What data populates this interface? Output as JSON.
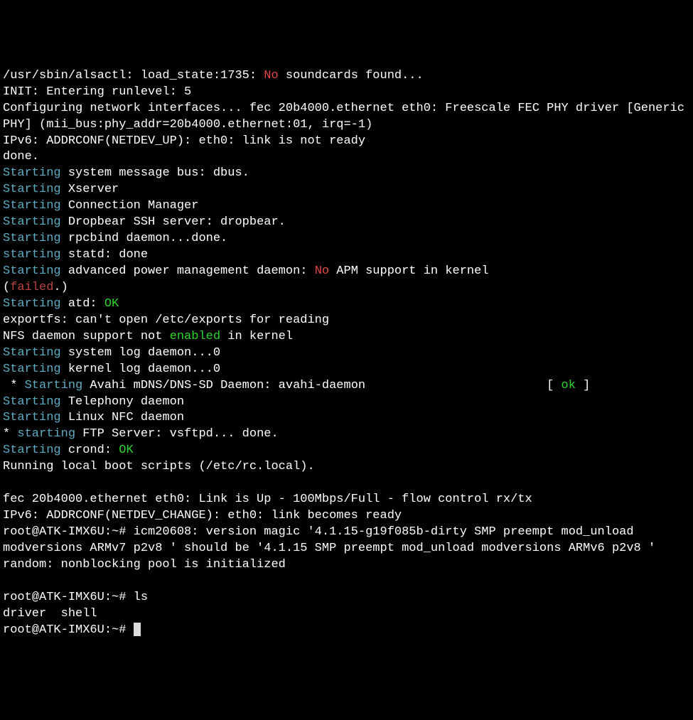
{
  "lines": [
    {
      "segments": [
        {
          "t": "/usr/sbin/alsactl: load_state:1735: ",
          "c": "white"
        },
        {
          "t": "No",
          "c": "red"
        },
        {
          "t": " soundcards found...",
          "c": "white"
        }
      ]
    },
    {
      "segments": [
        {
          "t": "INIT: Entering runlevel: 5",
          "c": "white"
        }
      ]
    },
    {
      "segments": [
        {
          "t": "Configuring network interfaces... fec 20b4000.ethernet eth0: Freescale FEC PHY driver [Generic PHY] (mii_bus:phy_addr=20b4000.ethernet:01, irq=-1)",
          "c": "white"
        }
      ]
    },
    {
      "segments": [
        {
          "t": "IPv6: ADDRCONF(NETDEV_UP): eth0: link is not ready",
          "c": "white"
        }
      ]
    },
    {
      "segments": [
        {
          "t": "done.",
          "c": "white"
        }
      ]
    },
    {
      "segments": [
        {
          "t": "Starting",
          "c": "cyan"
        },
        {
          "t": " system message bus: dbus.",
          "c": "white"
        }
      ]
    },
    {
      "segments": [
        {
          "t": "Starting",
          "c": "cyan"
        },
        {
          "t": " Xserver",
          "c": "white"
        }
      ]
    },
    {
      "segments": [
        {
          "t": "Starting",
          "c": "cyan"
        },
        {
          "t": " Connection Manager",
          "c": "white"
        }
      ]
    },
    {
      "segments": [
        {
          "t": "Starting",
          "c": "cyan"
        },
        {
          "t": " Dropbear SSH server: dropbear.",
          "c": "white"
        }
      ]
    },
    {
      "segments": [
        {
          "t": "Starting",
          "c": "cyan"
        },
        {
          "t": " rpcbind daemon...done.",
          "c": "white"
        }
      ]
    },
    {
      "segments": [
        {
          "t": "starting",
          "c": "cyan"
        },
        {
          "t": " statd: done",
          "c": "white"
        }
      ]
    },
    {
      "segments": [
        {
          "t": "Starting",
          "c": "cyan"
        },
        {
          "t": " advanced power management daemon: ",
          "c": "white"
        },
        {
          "t": "No",
          "c": "red"
        },
        {
          "t": " APM support in kernel",
          "c": "white"
        }
      ]
    },
    {
      "segments": [
        {
          "t": "(",
          "c": "white"
        },
        {
          "t": "failed",
          "c": "darkred"
        },
        {
          "t": ".)",
          "c": "white"
        }
      ]
    },
    {
      "segments": [
        {
          "t": "Starting",
          "c": "cyan"
        },
        {
          "t": " atd: ",
          "c": "white"
        },
        {
          "t": "OK",
          "c": "green"
        }
      ]
    },
    {
      "segments": [
        {
          "t": "exportfs: can't open /etc/exports for reading",
          "c": "white"
        }
      ]
    },
    {
      "segments": [
        {
          "t": "NFS daemon support not ",
          "c": "white"
        },
        {
          "t": "enabled",
          "c": "green"
        },
        {
          "t": " in kernel",
          "c": "white"
        }
      ]
    },
    {
      "segments": [
        {
          "t": "Starting",
          "c": "cyan"
        },
        {
          "t": " system log daemon...0",
          "c": "white"
        }
      ]
    },
    {
      "segments": [
        {
          "t": "Starting",
          "c": "cyan"
        },
        {
          "t": " kernel log daemon...0",
          "c": "white"
        }
      ]
    },
    {
      "segments": [
        {
          "t": " * ",
          "c": "white"
        },
        {
          "t": "Starting",
          "c": "cyan"
        },
        {
          "t": " Avahi mDNS/DNS-SD Daemon: avahi-daemon                         ",
          "c": "white"
        },
        {
          "t": "[ ",
          "c": "white"
        },
        {
          "t": "ok",
          "c": "green"
        },
        {
          "t": " ]",
          "c": "white"
        }
      ]
    },
    {
      "segments": [
        {
          "t": "Starting",
          "c": "cyan"
        },
        {
          "t": " Telephony daemon",
          "c": "white"
        }
      ]
    },
    {
      "segments": [
        {
          "t": "Starting",
          "c": "cyan"
        },
        {
          "t": " Linux NFC daemon",
          "c": "white"
        }
      ]
    },
    {
      "segments": [
        {
          "t": "* ",
          "c": "white"
        },
        {
          "t": "starting",
          "c": "cyan"
        },
        {
          "t": " FTP Server: vsftpd... done.",
          "c": "white"
        }
      ]
    },
    {
      "segments": [
        {
          "t": "Starting",
          "c": "cyan"
        },
        {
          "t": " crond: ",
          "c": "white"
        },
        {
          "t": "OK",
          "c": "green"
        }
      ]
    },
    {
      "segments": [
        {
          "t": "Running local boot scripts (/etc/rc.local).",
          "c": "white"
        }
      ]
    },
    {
      "segments": [
        {
          "t": " ",
          "c": "white"
        }
      ]
    },
    {
      "segments": [
        {
          "t": "fec 20b4000.ethernet eth0: Link is Up - 100Mbps/Full - flow control rx/tx",
          "c": "white"
        }
      ]
    },
    {
      "segments": [
        {
          "t": "IPv6: ADDRCONF(NETDEV_CHANGE): eth0: link becomes ready",
          "c": "white"
        }
      ]
    },
    {
      "segments": [
        {
          "t": "root@ATK-IMX6U:~# icm20608: version magic '4.1.15-g19f085b-dirty SMP preempt mod_unload modversions ARMv7 p2v8 ' should be '4.1.15 SMP preempt mod_unload modversions ARMv6 p2v8 '",
          "c": "white"
        }
      ]
    },
    {
      "segments": [
        {
          "t": "random: nonblocking pool is initialized",
          "c": "white"
        }
      ]
    },
    {
      "segments": [
        {
          "t": " ",
          "c": "white"
        }
      ]
    },
    {
      "segments": [
        {
          "t": "root@ATK-IMX6U:~# ls",
          "c": "white"
        }
      ]
    },
    {
      "segments": [
        {
          "t": "driver  shell",
          "c": "white"
        }
      ]
    }
  ],
  "prompt": "root@ATK-IMX6U:~# "
}
